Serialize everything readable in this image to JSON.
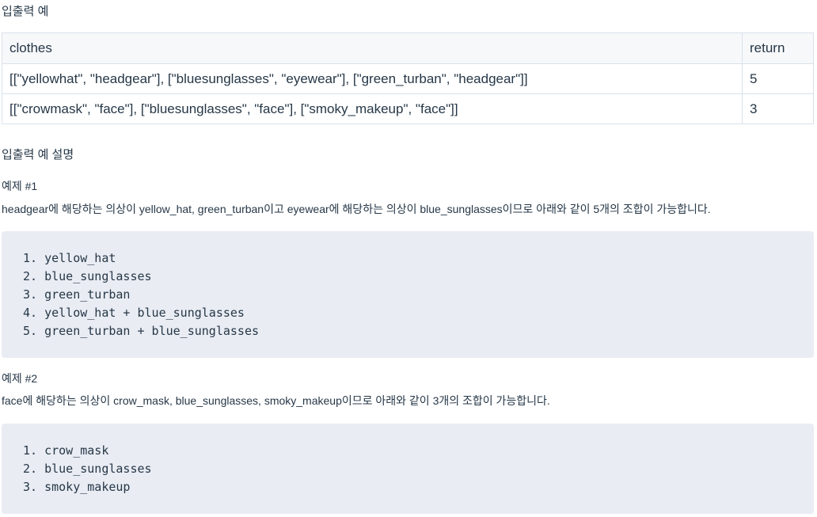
{
  "io_heading": "입출력 예",
  "table": {
    "headers": [
      "clothes",
      "return"
    ],
    "rows": [
      {
        "clothes": "[[\"yellowhat\", \"headgear\"], [\"bluesunglasses\", \"eyewear\"], [\"green_turban\", \"headgear\"]]",
        "return": "5"
      },
      {
        "clothes": "[[\"crowmask\", \"face\"], [\"bluesunglasses\", \"face\"], [\"smoky_makeup\", \"face\"]]",
        "return": "3"
      }
    ]
  },
  "explain_heading": "입출력 예 설명",
  "examples": [
    {
      "title": "예제 #1",
      "description": "headgear에 해당하는 의상이 yellow_hat, green_turban이고 eyewear에 해당하는 의상이 blue_sunglasses이므로 아래와 같이 5개의 조합이 가능합니다.",
      "lines": [
        "1. yellow_hat",
        "2. blue_sunglasses",
        "3. green_turban",
        "4. yellow_hat + blue_sunglasses",
        "5. green_turban + blue_sunglasses"
      ]
    },
    {
      "title": "예제 #2",
      "description": "face에 해당하는 의상이 crow_mask, blue_sunglasses, smoky_makeup이므로 아래와 같이 3개의 조합이 가능합니다.",
      "lines": [
        "1. crow_mask",
        "2. blue_sunglasses",
        "3. smoky_makeup"
      ]
    }
  ]
}
